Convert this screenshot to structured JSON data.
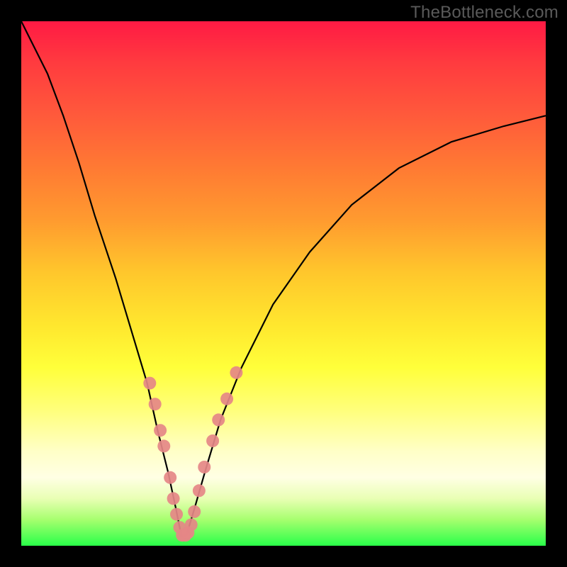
{
  "watermark": "TheBottleneck.com",
  "chart_data": {
    "type": "line",
    "title": "",
    "xlabel": "",
    "ylabel": "",
    "xlim": [
      0,
      100
    ],
    "ylim": [
      0,
      100
    ],
    "series": [
      {
        "name": "bottleneck-curve",
        "x": [
          0,
          2,
          5,
          8,
          11,
          14,
          18,
          21,
          24,
          26,
          28,
          29.5,
          30.5,
          31.5,
          33,
          35,
          38,
          42,
          48,
          55,
          63,
          72,
          82,
          92,
          100
        ],
        "y": [
          100,
          96,
          90,
          82,
          73,
          63,
          51,
          41,
          31,
          22,
          14,
          7,
          2,
          2,
          7,
          14,
          24,
          34,
          46,
          56,
          65,
          72,
          77,
          80,
          82
        ]
      }
    ],
    "highlight_points": {
      "name": "data-markers",
      "color": "#e58787",
      "points": [
        {
          "x": 24.5,
          "y": 31
        },
        {
          "x": 25.5,
          "y": 27
        },
        {
          "x": 26.5,
          "y": 22
        },
        {
          "x": 27.2,
          "y": 19
        },
        {
          "x": 28.4,
          "y": 13
        },
        {
          "x": 29.0,
          "y": 9
        },
        {
          "x": 29.6,
          "y": 6
        },
        {
          "x": 30.2,
          "y": 3.5
        },
        {
          "x": 30.7,
          "y": 2
        },
        {
          "x": 31.3,
          "y": 2
        },
        {
          "x": 31.8,
          "y": 2.5
        },
        {
          "x": 32.4,
          "y": 4
        },
        {
          "x": 33.0,
          "y": 6.5
        },
        {
          "x": 33.9,
          "y": 10.5
        },
        {
          "x": 34.9,
          "y": 15
        },
        {
          "x": 36.5,
          "y": 20
        },
        {
          "x": 37.6,
          "y": 24
        },
        {
          "x": 39.2,
          "y": 28
        },
        {
          "x": 41.0,
          "y": 33
        }
      ]
    }
  }
}
